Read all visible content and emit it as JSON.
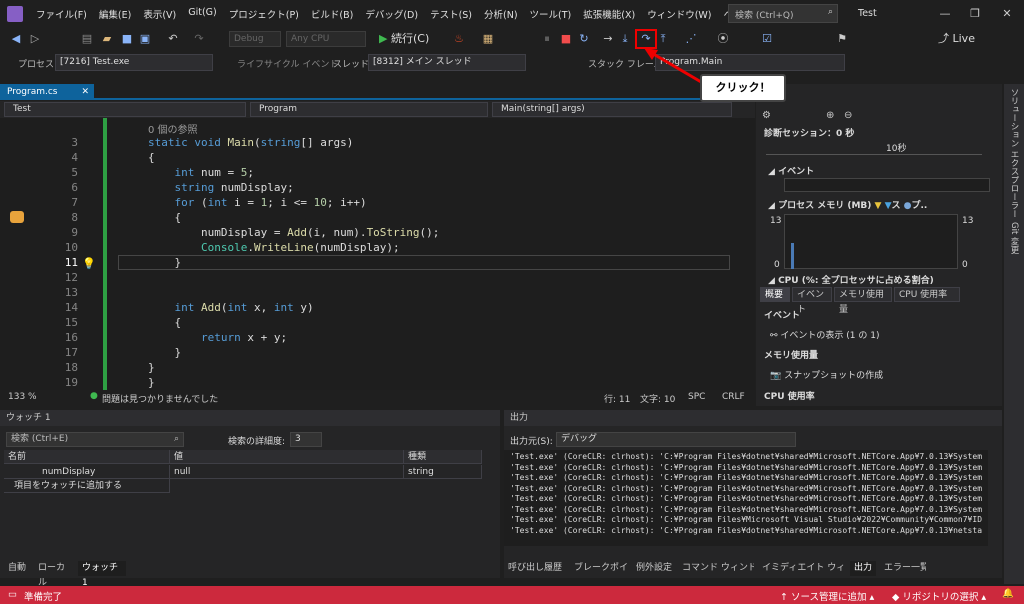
{
  "menu": {
    "items": [
      "ファイル(F)",
      "編集(E)",
      "表示(V)",
      "Git(G)",
      "プロジェクト(P)",
      "ビルド(B)",
      "デバッグ(D)",
      "テスト(S)",
      "分析(N)",
      "ツール(T)",
      "拡張機能(X)",
      "ウィンドウ(W)",
      "ヘルプ(H)"
    ],
    "search_placeholder": "検索 (Ctrl+Q)",
    "window_title": "Test"
  },
  "toolbar": {
    "config": "Debug",
    "platform": "Any CPU",
    "continue_label": "続行(C)",
    "live_share": "Live Share"
  },
  "debug_bar": {
    "process_label": "プロセス:",
    "process_value": "[7216] Test.exe",
    "lifecycle_label": "ライフサイクル イベント",
    "thread_label": "スレッド:",
    "thread_value": "[8312] メイン スレッド",
    "stack_label": "スタック フレーム:",
    "stack_value": "Program.Main"
  },
  "callout": {
    "text": "クリック！"
  },
  "editor": {
    "tab": "Program.cs",
    "nav_project": "Test",
    "nav_class": "Program",
    "nav_member": "Main(string[] args)",
    "ref_count": "0 個の参照",
    "lines": [
      {
        "n": "3",
        "t": "static void Main(string[] args)"
      },
      {
        "n": "4",
        "t": "{"
      },
      {
        "n": "5",
        "t": "    int num = 5;"
      },
      {
        "n": "6",
        "t": "    string numDisplay;"
      },
      {
        "n": "7",
        "t": "    for (int i = 1; i <= 10; i++)"
      },
      {
        "n": "8",
        "t": "    {"
      },
      {
        "n": "9",
        "t": "        numDisplay = Add(i, num).ToString();"
      },
      {
        "n": "10",
        "t": "        Console.WriteLine(numDisplay);"
      },
      {
        "n": "11",
        "t": "    }"
      },
      {
        "n": "12",
        "t": ""
      },
      {
        "n": "13",
        "t": ""
      },
      {
        "n": "14",
        "t": "    int Add(int x, int y)"
      },
      {
        "n": "15",
        "t": "    {"
      },
      {
        "n": "16",
        "t": "        return x + y;"
      },
      {
        "n": "17",
        "t": "    }"
      },
      {
        "n": "18",
        "t": "}"
      },
      {
        "n": "19",
        "t": "}"
      }
    ],
    "status": {
      "zoom": "133 %",
      "issues": "問題は見つかりませんでした",
      "line": "行: 11",
      "col": "文字: 10",
      "spc": "SPC",
      "crlf": "CRLF"
    }
  },
  "diagnostics": {
    "session": "診断セッション：0 秒",
    "marker": "10秒",
    "events": "イベント",
    "memory": "プロセス メモリ (MB)",
    "legend_a": "ス",
    "legend_b": "プ..",
    "mem_max": "13",
    "mem_min": "0",
    "cpu": "CPU (%: 全プロセッサに占める割合)",
    "tabs": [
      "概要",
      "イベント",
      "メモリ使用量",
      "CPU 使用率"
    ],
    "events_header": "イベント",
    "events_show": "イベントの表示 (1 の 1)",
    "mem_header": "メモリ使用量",
    "snapshot": "スナップショットの作成",
    "cpu_header": "CPU 使用率"
  },
  "watch": {
    "title": "ウォッチ 1",
    "search": "検索 (Ctrl+E)",
    "depth_label": "検索の詳細度:",
    "depth": "3",
    "cols": [
      "名前",
      "値",
      "種類"
    ],
    "rows": [
      {
        "name": "numDisplay",
        "value": "null",
        "type": "string"
      }
    ],
    "add_row": "項目をウォッチに追加する",
    "tabs": [
      "自動",
      "ローカル",
      "ウォッチ 1"
    ]
  },
  "output": {
    "title": "出力",
    "source_label": "出力元(S):",
    "source": "デバッグ",
    "lines": [
      "'Test.exe' (CoreCLR: clrhost): 'C:¥Program Files¥dotnet¥shared¥Microsoft.NETCore.App¥7.0.13¥System",
      "'Test.exe' (CoreCLR: clrhost): 'C:¥Program Files¥dotnet¥shared¥Microsoft.NETCore.App¥7.0.13¥System",
      "'Test.exe' (CoreCLR: clrhost): 'C:¥Program Files¥dotnet¥shared¥Microsoft.NETCore.App¥7.0.13¥System",
      "'Test.exe' (CoreCLR: clrhost): 'C:¥Program Files¥dotnet¥shared¥Microsoft.NETCore.App¥7.0.13¥System",
      "'Test.exe' (CoreCLR: clrhost): 'C:¥Program Files¥dotnet¥shared¥Microsoft.NETCore.App¥7.0.13¥System",
      "'Test.exe' (CoreCLR: clrhost): 'C:¥Program Files¥dotnet¥shared¥Microsoft.NETCore.App¥7.0.13¥System",
      "'Test.exe' (CoreCLR: clrhost): 'C:¥Program Files¥Microsoft Visual Studio¥2022¥Community¥Common7¥ID",
      "'Test.exe' (CoreCLR: clrhost): 'C:¥Program Files¥dotnet¥shared¥Microsoft.NETCore.App¥7.0.13¥netsta"
    ],
    "tabs": [
      "呼び出し履歴",
      "ブレークポイント",
      "例外設定",
      "コマンド ウィンドウ",
      "イミディエイト ウィンドウ",
      "出力",
      "エラー一覧"
    ]
  },
  "right_rail": {
    "solution": "ソリューション エクスプローラー",
    "git": "Git 変更"
  },
  "status": {
    "ready": "準備完了",
    "source_control": "ソース管理に追加",
    "repo": "リポジトリの選択"
  },
  "colors": {
    "accent": "#0e639c",
    "status_bar": "#cc293d",
    "callout_border": "#e00000"
  }
}
